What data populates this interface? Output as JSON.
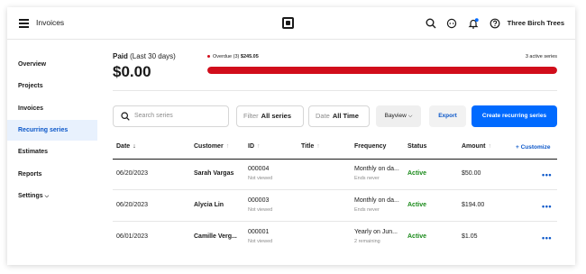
{
  "header": {
    "app_title": "Invoices",
    "business_name": "Three Birch Trees",
    "icons": [
      "menu-icon",
      "square-logo-icon",
      "search-icon",
      "messages-icon",
      "notifications-icon",
      "help-icon"
    ],
    "notification_dot_color": "#006aff"
  },
  "sidebar": {
    "items": [
      {
        "label": "Overview"
      },
      {
        "label": "Projects"
      },
      {
        "label": "Invoices"
      },
      {
        "label": "Recurring series"
      },
      {
        "label": "Estimates"
      },
      {
        "label": "Reports"
      },
      {
        "label": "Settings"
      }
    ],
    "active": "Recurring series"
  },
  "summary": {
    "paid_label_bold": "Paid",
    "paid_label_rest": " (Last 30 days)",
    "paid_amount": "$0.00",
    "overdue_label": "Overdue (3)",
    "overdue_amount": "$245.05",
    "active_series": "3 active series",
    "overdue_fraction": 1.0,
    "overdue_color": "#d10d1b"
  },
  "toolbar": {
    "search_placeholder": "Search series",
    "filter_key": "Filter",
    "filter_value": "All series",
    "date_key": "Date",
    "date_value": "All Time",
    "location": "Bayview",
    "export_label": "Export",
    "create_label": "Create recurring series",
    "accent": "#006aff"
  },
  "table": {
    "columns": [
      "Date",
      "Customer",
      "ID",
      "Title",
      "Frequency",
      "Status",
      "Amount"
    ],
    "customize_label": "+ Customize",
    "rows": [
      {
        "date": "06/20/2023",
        "customer": "Sarah Vargas",
        "id": "000004",
        "id_sub": "Not viewed",
        "frequency": "Monthly on da...",
        "frequency_sub": "Ends never",
        "status": "Active",
        "amount": "$50.00"
      },
      {
        "date": "06/20/2023",
        "customer": "Alycia Lin",
        "id": "000003",
        "id_sub": "Not viewed",
        "frequency": "Monthly on da...",
        "frequency_sub": "Ends never",
        "status": "Active",
        "amount": "$194.00"
      },
      {
        "date": "06/01/2023",
        "customer": "Camille Verg...",
        "id": "000001",
        "id_sub": "Not viewed",
        "frequency": "Yearly on Jun...",
        "frequency_sub": "2 remaining",
        "status": "Active",
        "amount": "$1.05"
      }
    ],
    "status_color": "#1a8a1a"
  }
}
